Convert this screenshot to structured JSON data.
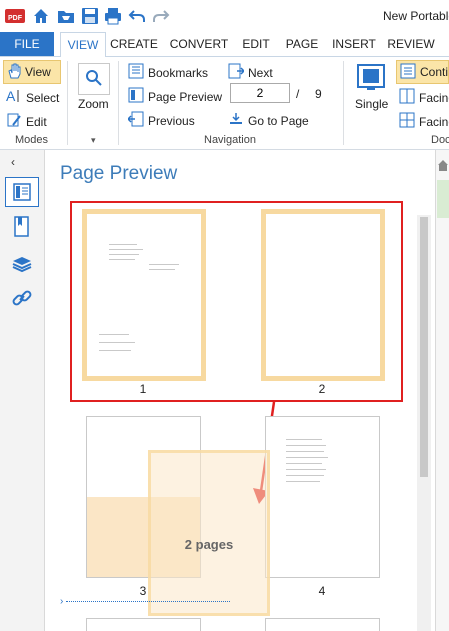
{
  "app": {
    "title": "New Portable"
  },
  "quick_access": [
    "pdf-logo-icon",
    "home-icon",
    "open-folder-icon",
    "save-icon",
    "print-icon",
    "undo-icon",
    "redo-icon"
  ],
  "tabs": [
    {
      "label": "FILE"
    },
    {
      "label": "VIEW"
    },
    {
      "label": "CREATE"
    },
    {
      "label": "CONVERT"
    },
    {
      "label": "EDIT"
    },
    {
      "label": "PAGE"
    },
    {
      "label": "INSERT"
    },
    {
      "label": "REVIEW"
    }
  ],
  "ribbon": {
    "modes": {
      "view": "View",
      "select": "Select",
      "edit": "Edit",
      "group": "Modes"
    },
    "zoom": {
      "label": "Zoom"
    },
    "navigation": {
      "bookmarks": "Bookmarks",
      "page_preview": "Page Preview",
      "previous": "Previous",
      "next": "Next",
      "current_page": "2",
      "separator": "/",
      "total_pages": "9",
      "go_to_page": "Go to Page",
      "group": "Navigation"
    },
    "document": {
      "single": "Single",
      "continuous": "Conti",
      "facing": "Facing",
      "facing2": "Facing",
      "group": "Doc"
    }
  },
  "panel": {
    "title": "Page Preview",
    "pages": [
      {
        "number": "1"
      },
      {
        "number": "2"
      },
      {
        "number": "3"
      },
      {
        "number": "4"
      }
    ],
    "drag_label": "2 pages"
  },
  "colors": {
    "accent": "#2b74c7",
    "selection_border": "#e02020",
    "thumb_highlight": "#f7d9a0",
    "panel_title": "#3d7cb9"
  }
}
